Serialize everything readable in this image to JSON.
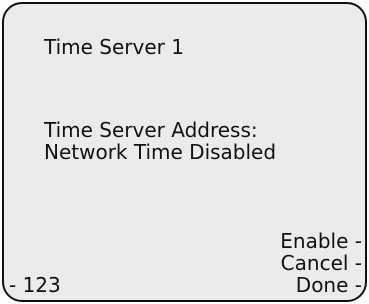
{
  "screen": {
    "title": "Time Server 1",
    "field_label": "Time Server Address:",
    "field_value": "Network Time Disabled"
  },
  "softkeys": {
    "right": [
      {
        "label": "Enable -"
      },
      {
        "label": "Cancel -"
      },
      {
        "label": "Done -"
      }
    ],
    "left": {
      "label": "- 123"
    }
  },
  "colors": {
    "background": "#ebebeb",
    "border": "#111111",
    "text": "#111111"
  }
}
